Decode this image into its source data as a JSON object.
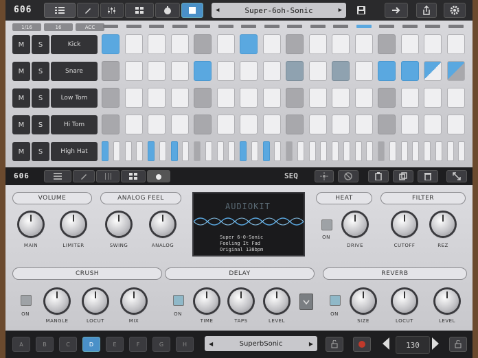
{
  "app": {
    "logo": "606"
  },
  "topbar": {
    "preset_name": "Super-6oh-Sonic",
    "prev_label": "◀",
    "next_label": "▶"
  },
  "sequencer": {
    "small_buttons": [
      "1/16",
      "16",
      "ACC"
    ],
    "tracks": [
      {
        "mute": "M",
        "solo": "S",
        "name": "Kick"
      },
      {
        "mute": "M",
        "solo": "S",
        "name": "Snare"
      },
      {
        "mute": "M",
        "solo": "S",
        "name": "Low Tom"
      },
      {
        "mute": "M",
        "solo": "S",
        "name": "Hi Tom"
      },
      {
        "mute": "M",
        "solo": "S",
        "name": "High Hat"
      }
    ],
    "current_step": 11
  },
  "bar2": {
    "logo": "606",
    "seq_label": "SEQ"
  },
  "panel": {
    "sections": {
      "volume": "VOLUME",
      "analog_feel": "ANALOG FEEL",
      "heat": "HEAT",
      "filter": "FILTER",
      "crush": "CRUSH",
      "delay": "DELAY",
      "reverb": "REVERB"
    },
    "knobs": {
      "main": "MAIN",
      "limiter": "LIMITER",
      "swing": "SWING",
      "analog": "ANALOG",
      "drive": "DRIVE",
      "cutoff": "CUTOFF",
      "rez": "REZ",
      "mangle": "MANGLE",
      "locut1": "LOCUT",
      "mix": "MIX",
      "time": "TIME",
      "taps": "TAPS",
      "level1": "LEVEL",
      "size": "SIZE",
      "locut2": "LOCUT",
      "level2": "LEVEL"
    },
    "on_label": "ON",
    "display": {
      "logo": "AUDIOKIT",
      "line1": "Super 6-0-Sonic",
      "line2": "Feeling It Fad",
      "line3": "Original 138bpm"
    }
  },
  "bottom": {
    "patterns": [
      "A",
      "B",
      "C",
      "D",
      "E",
      "F",
      "G",
      "H"
    ],
    "active_pattern": "D",
    "kit_name": "SuperbSonic",
    "tempo": "130"
  },
  "colors": {
    "accent": "#5aa8e0",
    "background": "#1e1e20",
    "panel": "#d0d0d4"
  }
}
